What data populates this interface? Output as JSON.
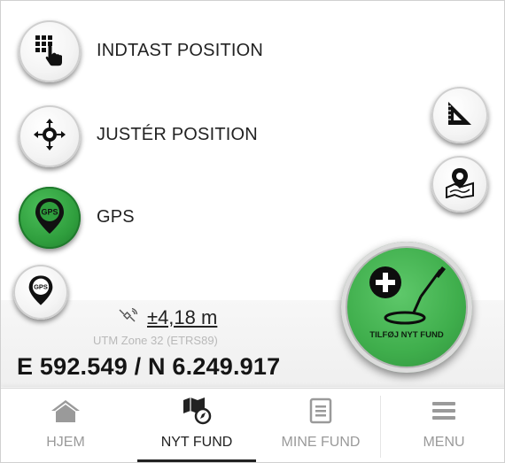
{
  "menu": {
    "enter_position": "INDTAST POSITION",
    "adjust_position": "JUSTÉR POSITION",
    "gps": "GPS"
  },
  "icons": {
    "enter_position": "keypad-hand-icon",
    "adjust_position": "crosshair-move-icon",
    "gps": "gps-pin-icon",
    "ruler": "set-square-ruler-icon",
    "map": "map-pin-icon",
    "add_find": "plus-metal-detector-icon"
  },
  "gps_badge": "GPS",
  "location": {
    "accuracy": "±4,18 m",
    "zone": "UTM Zone 32 (ETRS89)",
    "coordinates": "E 592.549 / N 6.249.917"
  },
  "add_find_label": "TILFØJ NYT FUND",
  "nav": {
    "items": [
      {
        "label": "HJEM",
        "icon": "home-icon",
        "active": false
      },
      {
        "label": "NYT FUND",
        "icon": "map-compass-icon",
        "active": true
      },
      {
        "label": "MINE FUND",
        "icon": "document-list-icon",
        "active": false
      },
      {
        "label": "MENU",
        "icon": "hamburger-menu-icon",
        "active": false
      }
    ]
  },
  "colors": {
    "green": "#3fae4c",
    "dark_green": "#1f7a2c",
    "text": "#222222",
    "muted": "#9a9a9a"
  }
}
